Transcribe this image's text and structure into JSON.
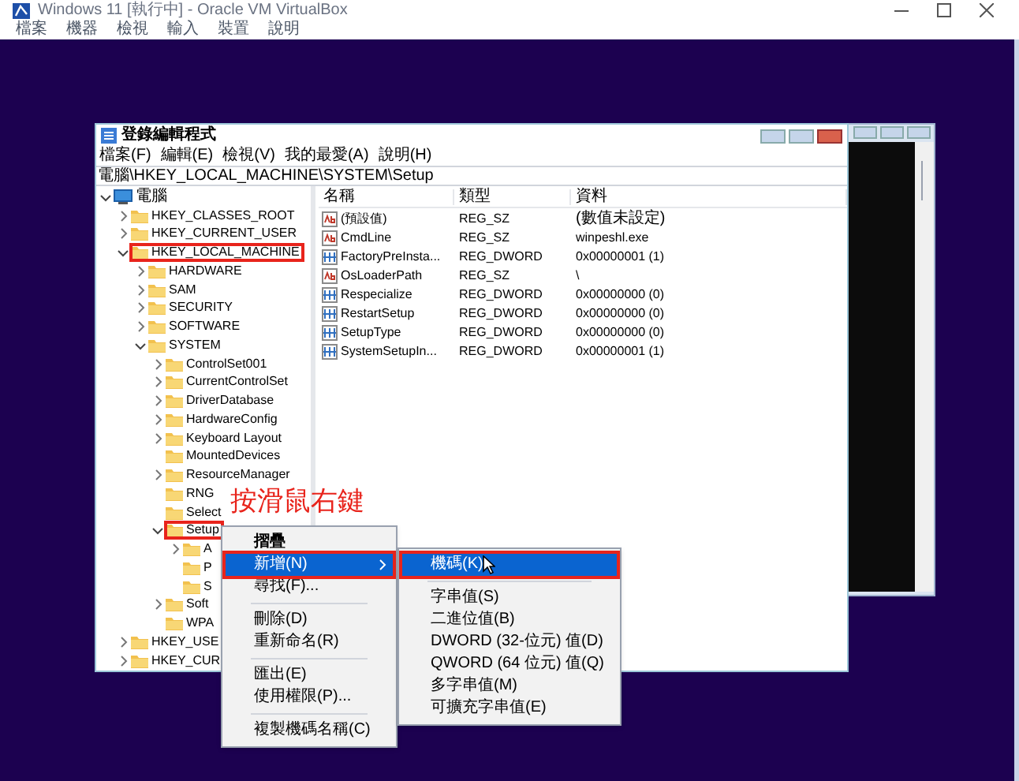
{
  "vm_window": {
    "title": "Windows 11 [執行中] - Oracle VM VirtualBox",
    "menu": [
      "檔案",
      "機器",
      "檢視",
      "輸入",
      "裝置",
      "說明"
    ]
  },
  "regedit": {
    "title": "登錄編輯程式",
    "menu": [
      "檔案(F)",
      "編輯(E)",
      "檢視(V)",
      "我的最愛(A)",
      "說明(H)"
    ],
    "address": "電腦\\HKEY_LOCAL_MACHINE\\SYSTEM\\Setup",
    "tree": [
      {
        "label": "電腦",
        "kind": "computer",
        "expanded": true,
        "annotated": false,
        "children": [
          {
            "label": "HKEY_CLASSES_ROOT",
            "expanded": false,
            "annotated": false
          },
          {
            "label": "HKEY_CURRENT_USER",
            "expanded": false,
            "annotated": false
          },
          {
            "label": "HKEY_LOCAL_MACHINE",
            "expanded": true,
            "annotated": true,
            "children": [
              {
                "label": "HARDWARE",
                "expanded": false,
                "annotated": false
              },
              {
                "label": "SAM",
                "expanded": false,
                "annotated": false
              },
              {
                "label": "SECURITY",
                "expanded": false,
                "annotated": false
              },
              {
                "label": "SOFTWARE",
                "expanded": false,
                "annotated": false
              },
              {
                "label": "SYSTEM",
                "expanded": true,
                "annotated": false,
                "children": [
                  {
                    "label": "ControlSet001",
                    "expanded": false,
                    "annotated": false
                  },
                  {
                    "label": "CurrentControlSet",
                    "expanded": false,
                    "annotated": false
                  },
                  {
                    "label": "DriverDatabase",
                    "expanded": false,
                    "annotated": false
                  },
                  {
                    "label": "HardwareConfig",
                    "expanded": false,
                    "annotated": false
                  },
                  {
                    "label": "Keyboard Layout",
                    "expanded": false,
                    "annotated": false
                  },
                  {
                    "label": "MountedDevices",
                    "annotated": false
                  },
                  {
                    "label": "ResourceManager",
                    "expanded": false,
                    "annotated": false
                  },
                  {
                    "label": "RNG",
                    "annotated": false
                  },
                  {
                    "label": "Select",
                    "annotated": false
                  },
                  {
                    "label": "Setup",
                    "expanded": true,
                    "annotated": true,
                    "children": [
                      {
                        "label": "A",
                        "expanded": false,
                        "annotated": false
                      },
                      {
                        "label": "P",
                        "annotated": false
                      },
                      {
                        "label": "S",
                        "annotated": false
                      }
                    ]
                  },
                  {
                    "label": "Soft",
                    "expanded": false,
                    "annotated": false
                  },
                  {
                    "label": "WPA",
                    "annotated": false
                  }
                ]
              }
            ]
          },
          {
            "label": "HKEY_USE",
            "expanded": false,
            "annotated": false
          },
          {
            "label": "HKEY_CUR",
            "expanded": false,
            "annotated": false
          }
        ]
      }
    ],
    "columns": [
      "名稱",
      "類型",
      "資料"
    ],
    "values": [
      {
        "kind": "string",
        "name": "(預設值)",
        "type": "REG_SZ",
        "data": "(數值未設定)"
      },
      {
        "kind": "string",
        "name": "CmdLine",
        "type": "REG_SZ",
        "data": "winpeshl.exe"
      },
      {
        "kind": "binary",
        "name": "FactoryPreInsta...",
        "type": "REG_DWORD",
        "data": "0x00000001 (1)"
      },
      {
        "kind": "string",
        "name": "OsLoaderPath",
        "type": "REG_SZ",
        "data": "\\"
      },
      {
        "kind": "binary",
        "name": "Respecialize",
        "type": "REG_DWORD",
        "data": "0x00000000 (0)"
      },
      {
        "kind": "binary",
        "name": "RestartSetup",
        "type": "REG_DWORD",
        "data": "0x00000000 (0)"
      },
      {
        "kind": "binary",
        "name": "SetupType",
        "type": "REG_DWORD",
        "data": "0x00000000 (0)"
      },
      {
        "kind": "binary",
        "name": "SystemSetupIn...",
        "type": "REG_DWORD",
        "data": "0x00000001 (1)"
      }
    ]
  },
  "annotation": "按滑鼠右鍵",
  "context_menu": {
    "items": [
      {
        "kind": "item",
        "label": "摺疊",
        "default": true,
        "selected": false,
        "annotated": false,
        "submenu": false
      },
      {
        "kind": "item",
        "label": "新增(N)",
        "default": false,
        "selected": true,
        "annotated": true,
        "submenu": true
      },
      {
        "kind": "item",
        "label": "尋找(F)...",
        "default": false,
        "selected": false,
        "annotated": false,
        "submenu": false
      },
      {
        "kind": "separator"
      },
      {
        "kind": "item",
        "label": "刪除(D)",
        "default": false,
        "selected": false,
        "annotated": false,
        "submenu": false
      },
      {
        "kind": "item",
        "label": "重新命名(R)",
        "default": false,
        "selected": false,
        "annotated": false,
        "submenu": false
      },
      {
        "kind": "separator"
      },
      {
        "kind": "item",
        "label": "匯出(E)",
        "default": false,
        "selected": false,
        "annotated": false,
        "submenu": false
      },
      {
        "kind": "item",
        "label": "使用權限(P)...",
        "default": false,
        "selected": false,
        "annotated": false,
        "submenu": false
      },
      {
        "kind": "separator"
      },
      {
        "kind": "item",
        "label": "複製機碼名稱(C)",
        "default": false,
        "selected": false,
        "annotated": false,
        "submenu": false
      }
    ]
  },
  "submenu": {
    "items": [
      {
        "kind": "item",
        "label": "機碼(K)",
        "default": false,
        "selected": true,
        "annotated": true,
        "submenu": false
      },
      {
        "kind": "separator"
      },
      {
        "kind": "item",
        "label": "字串值(S)",
        "default": false,
        "selected": false,
        "annotated": false,
        "submenu": false
      },
      {
        "kind": "item",
        "label": "二進位值(B)",
        "default": false,
        "selected": false,
        "annotated": false,
        "submenu": false
      },
      {
        "kind": "item",
        "label": "DWORD (32-位元) 值(D)",
        "default": false,
        "selected": false,
        "annotated": false,
        "submenu": false
      },
      {
        "kind": "item",
        "label": "QWORD (64 位元) 值(Q)",
        "default": false,
        "selected": false,
        "annotated": false,
        "submenu": false
      },
      {
        "kind": "item",
        "label": "多字串值(M)",
        "default": false,
        "selected": false,
        "annotated": false,
        "submenu": false
      },
      {
        "kind": "item",
        "label": "可擴充字串值(E)",
        "default": false,
        "selected": false,
        "annotated": false,
        "submenu": false
      }
    ]
  }
}
